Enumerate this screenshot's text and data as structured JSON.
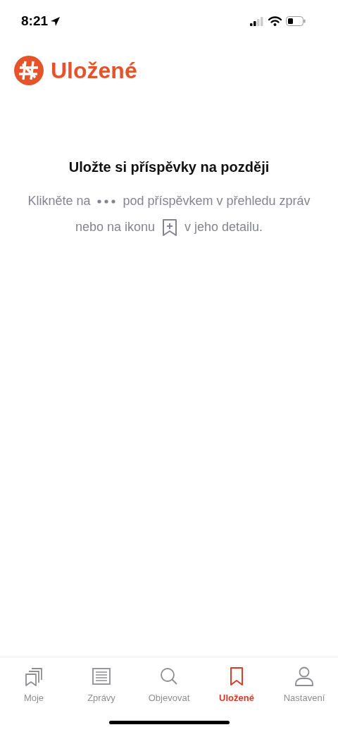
{
  "status_bar": {
    "time": "8:21"
  },
  "header": {
    "title": "Uložené"
  },
  "empty_state": {
    "heading": "Uložte si příspěvky na později",
    "line_1": [
      "Klikněte na",
      "pod příspěvkem v přehledu zpráv"
    ],
    "line_2": [
      "nebo na ikonu",
      "v jeho detailu."
    ]
  },
  "tabs": [
    {
      "label": "Moje",
      "selected": false
    },
    {
      "label": "Zprávy",
      "selected": false
    },
    {
      "label": "Objevovat",
      "selected": false
    },
    {
      "label": "Uložené",
      "selected": true
    },
    {
      "label": "Nastavení",
      "selected": false
    }
  ]
}
